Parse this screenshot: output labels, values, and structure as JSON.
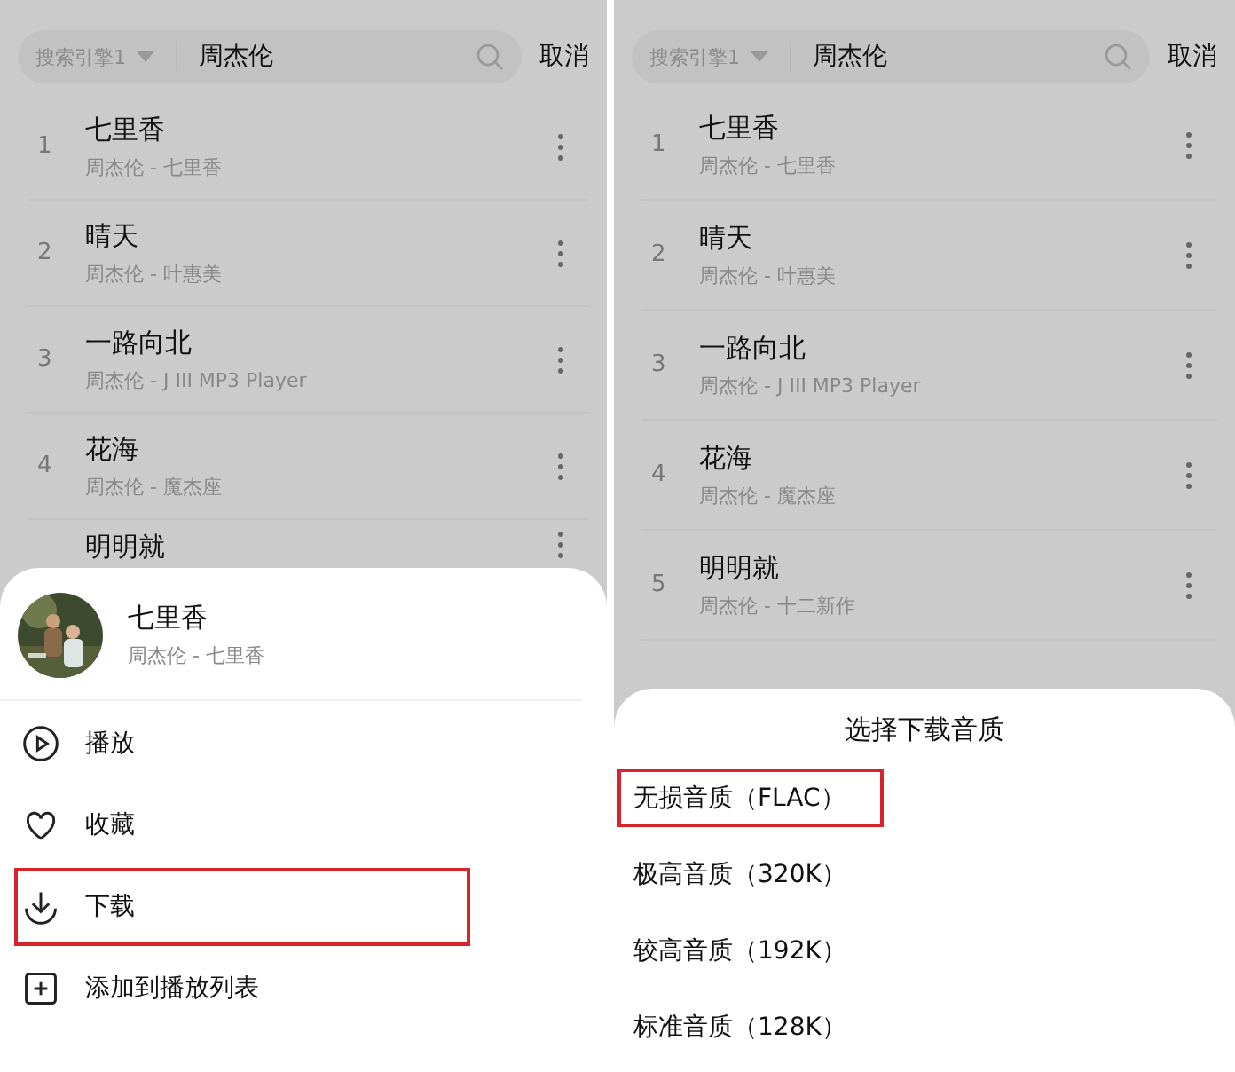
{
  "screens": [
    {
      "search": {
        "engine": "搜索引擎1",
        "query": "周杰伦",
        "cancel": "取消"
      },
      "songs": [
        {
          "number": "1",
          "title": "七里香",
          "subtitle": "周杰伦 - 七里香"
        },
        {
          "number": "2",
          "title": "晴天",
          "subtitle": "周杰伦 - 叶惠美"
        },
        {
          "number": "3",
          "title": "一路向北",
          "subtitle": "周杰伦 - J III MP3 Player"
        },
        {
          "number": "4",
          "title": "花海",
          "subtitle": "周杰伦 - 魔杰座"
        },
        {
          "title": "明明就"
        }
      ],
      "sheet": {
        "kind": "actions",
        "title": "七里香",
        "subtitle": "周杰伦 - 七里香",
        "items": [
          {
            "kind": "play",
            "label": "播放",
            "highlighted": false
          },
          {
            "kind": "favorite",
            "label": "收藏",
            "highlighted": false
          },
          {
            "kind": "download",
            "label": "下载",
            "highlighted": true
          },
          {
            "kind": "add",
            "label": "添加到播放列表",
            "highlighted": false
          }
        ]
      }
    },
    {
      "search": {
        "engine": "搜索引擎1",
        "query": "周杰伦",
        "cancel": "取消"
      },
      "songs": [
        {
          "number": "1",
          "title": "七里香",
          "subtitle": "周杰伦 - 七里香"
        },
        {
          "number": "2",
          "title": "晴天",
          "subtitle": "周杰伦 - 叶惠美"
        },
        {
          "number": "3",
          "title": "一路向北",
          "subtitle": "周杰伦 - J III MP3 Player"
        },
        {
          "number": "4",
          "title": "花海",
          "subtitle": "周杰伦 - 魔杰座"
        },
        {
          "number": "5",
          "title": "明明就",
          "subtitle": "周杰伦 - 十二新作"
        }
      ],
      "sheet": {
        "kind": "quality",
        "title": "选择下载音质",
        "items": [
          {
            "label": "无损音质（FLAC）",
            "highlighted": true
          },
          {
            "label": "极高音质（320K）",
            "highlighted": false
          },
          {
            "label": "较高音质（192K）",
            "highlighted": false
          },
          {
            "label": "标准音质（128K）",
            "highlighted": false
          }
        ]
      }
    }
  ]
}
